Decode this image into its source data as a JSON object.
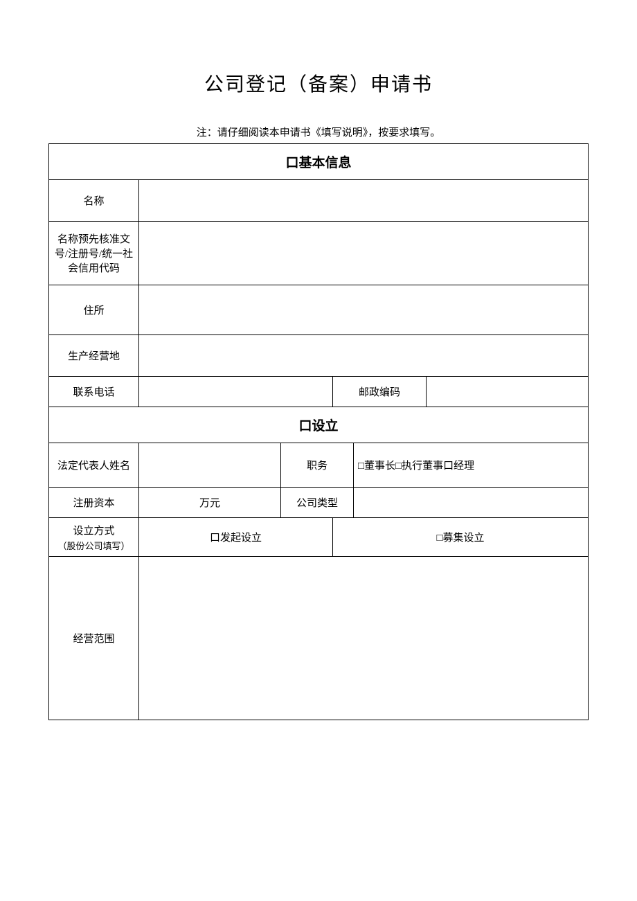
{
  "title": "公司登记（备案）申请书",
  "note": "注：请仔细阅读本申请书《填写说明》，按要求填写。",
  "section_basic": "口基本信息",
  "section_setup": "口设立",
  "labels": {
    "name": "名称",
    "code": "名称预先核准文号/注册号/统一社会信用代码",
    "address": "住所",
    "prod_loc": "生产经营地",
    "phone": "联系电话",
    "postal": "邮政编码",
    "legal_rep": "法定代表人姓名",
    "position": "职务",
    "position_opts": "□董事长□执行董事口经理",
    "reg_capital": "注册资本",
    "unit": "万元",
    "company_type": "公司类型",
    "setup_method": "设立方式",
    "setup_method_sub": "（股份公司填写）",
    "opt_launch": "口发起设立",
    "opt_raise": "□募集设立",
    "scope": "经营范围"
  }
}
